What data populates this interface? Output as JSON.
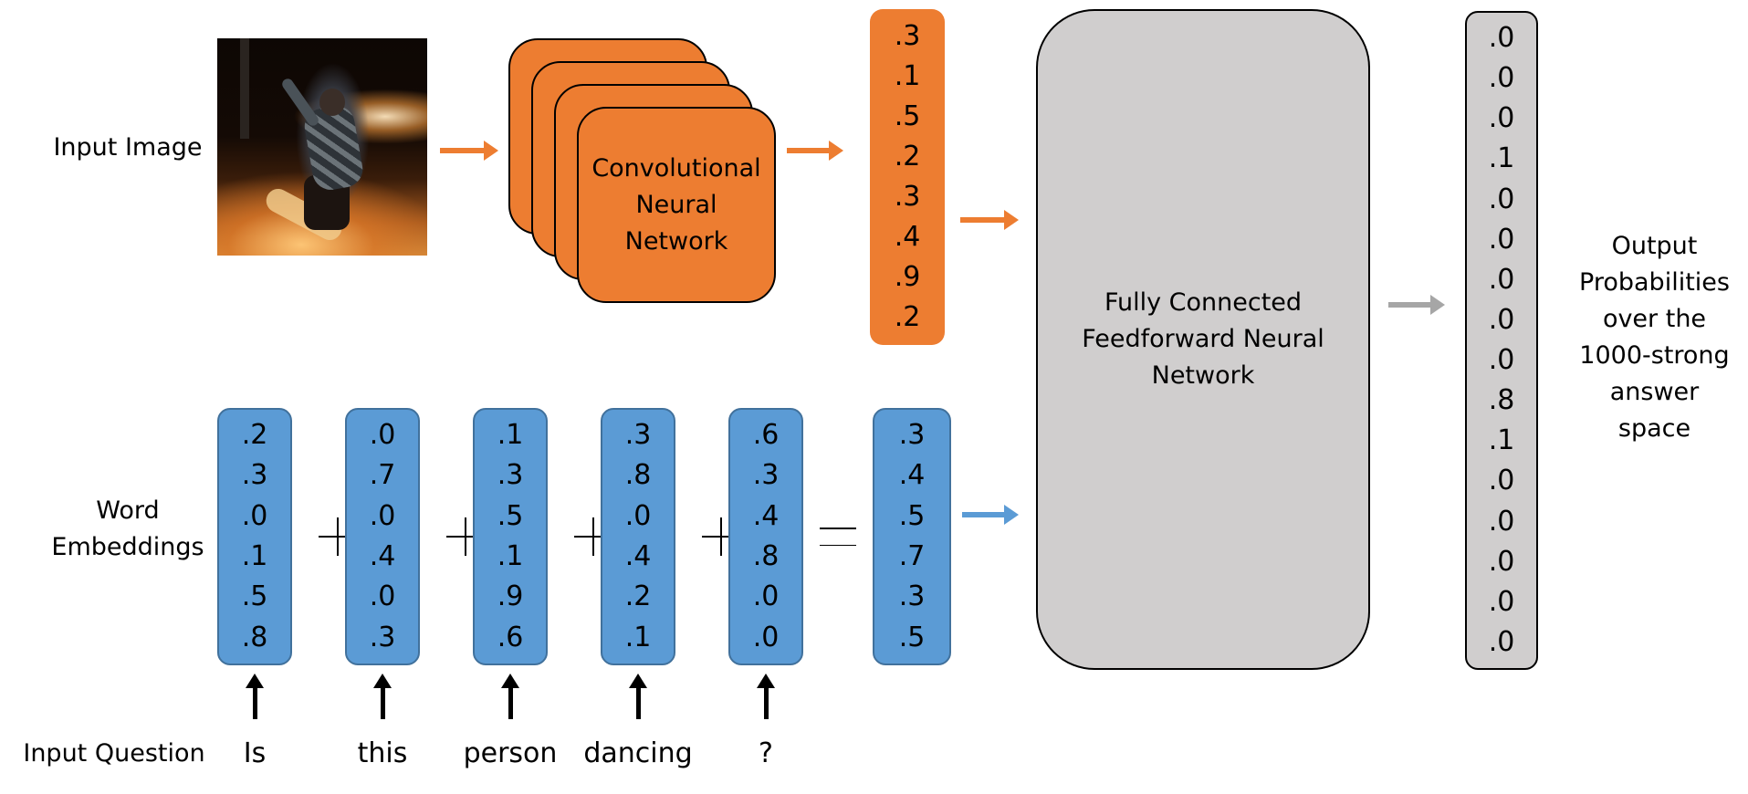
{
  "labels": {
    "input_image": "Input Image",
    "word_embeddings_line1": "Word",
    "word_embeddings_line2": "Embeddings",
    "input_question": "Input Question",
    "output_line1": "Output",
    "output_line2": "Probabilities",
    "output_line3": "over the",
    "output_line4": "1000-strong",
    "output_line5": "answer",
    "output_line6": "space"
  },
  "cnn": {
    "line1": "Convolutional",
    "line2": "Neural",
    "line3": "Network",
    "color": "#ed7d31"
  },
  "fc": {
    "line1": "Fully Connected",
    "line2": "Feedforward Neural",
    "line3": "Network",
    "color": "#d0cece"
  },
  "image_features": [
    ".3",
    ".1",
    ".5",
    ".2",
    ".3",
    ".4",
    ".9",
    ".2"
  ],
  "question_words": [
    "Is",
    "this",
    "person",
    "dancing",
    "?"
  ],
  "word_vectors": [
    [
      ".2",
      ".3",
      ".0",
      ".1",
      ".5",
      ".8"
    ],
    [
      ".0",
      ".7",
      ".0",
      ".4",
      ".0",
      ".3"
    ],
    [
      ".1",
      ".3",
      ".5",
      ".1",
      ".9",
      ".6"
    ],
    [
      ".3",
      ".8",
      ".0",
      ".4",
      ".2",
      ".1"
    ],
    [
      ".6",
      ".3",
      ".4",
      ".8",
      ".0",
      ".0"
    ]
  ],
  "sum_vector": [
    ".3",
    ".4",
    ".5",
    ".7",
    ".3",
    ".5"
  ],
  "output_probabilities": [
    ".0",
    ".0",
    ".0",
    ".1",
    ".0",
    ".0",
    ".0",
    ".0",
    ".0",
    ".8",
    ".1",
    ".0",
    ".0",
    ".0",
    ".0",
    ".0"
  ],
  "colors": {
    "orange": "#ed7d31",
    "blue": "#5b9bd5",
    "gray": "#d0cece",
    "gray_arrow": "#a6a6a6"
  }
}
